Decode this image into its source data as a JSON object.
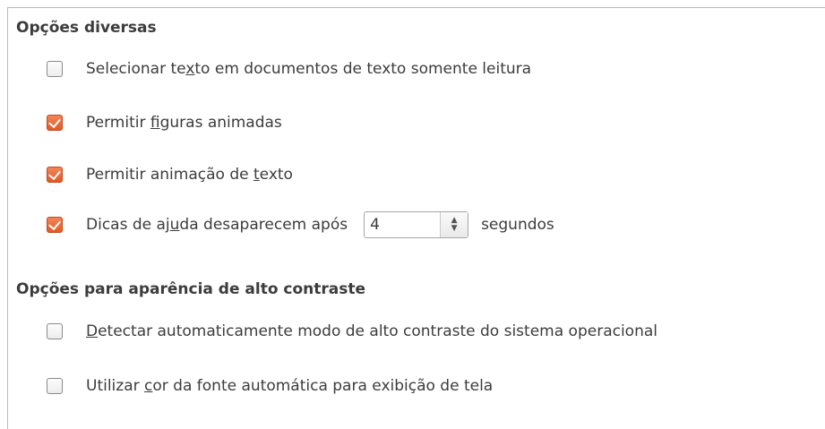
{
  "section_misc": {
    "title": "Opções diversas",
    "select_text_readonly": {
      "checked": false,
      "label_pre": "Selecionar te",
      "label_mn": "x",
      "label_post": "to em documentos de texto somente leitura"
    },
    "allow_animated_images": {
      "checked": true,
      "label_pre": "Permitir ",
      "label_mn": "f",
      "label_post": "iguras animadas"
    },
    "allow_text_animation": {
      "checked": true,
      "label_pre": "Permitir animação de ",
      "label_mn": "t",
      "label_post": "exto"
    },
    "help_tips_disappear": {
      "checked": true,
      "label_pre": "Dicas de aj",
      "label_mn": "u",
      "label_post": "da desaparecem após",
      "value": "4",
      "suffix": "segundos"
    }
  },
  "section_contrast": {
    "title": "Opções para aparência de alto contraste",
    "detect_high_contrast": {
      "checked": false,
      "label_pre": "",
      "label_mn": "D",
      "label_post": "etectar automaticamente modo de alto contraste do sistema operacional"
    },
    "auto_font_color": {
      "checked": false,
      "label_pre": "Utilizar ",
      "label_mn": "c",
      "label_post": "or da fonte automática para exibição de tela"
    }
  },
  "colors": {
    "checkbox_checked": "#e05a24",
    "border": "#b9b9b9",
    "text": "#3c3c3c"
  }
}
